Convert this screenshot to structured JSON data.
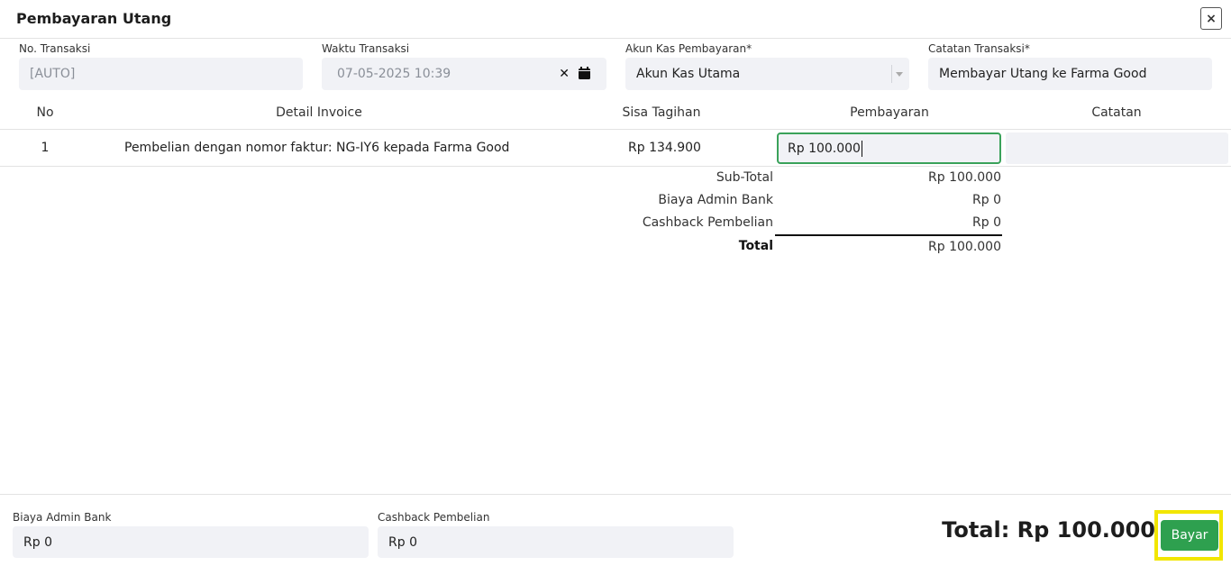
{
  "header": {
    "title": "Pembayaran Utang",
    "close_label": "×"
  },
  "fields": {
    "no_transaksi": {
      "label": "No. Transaksi",
      "value": "[AUTO]"
    },
    "waktu_transaksi": {
      "label": "Waktu Transaksi",
      "value": "07-05-2025 10:39"
    },
    "akun_kas": {
      "label": "Akun Kas Pembayaran*",
      "value": "Akun Kas Utama"
    },
    "catatan": {
      "label": "Catatan Transaksi*",
      "value": "Membayar Utang ke Farma Good"
    }
  },
  "table": {
    "headers": [
      "No",
      "Detail Invoice",
      "Sisa Tagihan",
      "Pembayaran",
      "Catatan"
    ],
    "rows": [
      {
        "no": "1",
        "detail": "Pembelian dengan nomor faktur: NG-IY6 kepada Farma Good",
        "sisa": "Rp 134.900",
        "pembayaran": "Rp 100.000",
        "catatan": ""
      }
    ]
  },
  "summary": {
    "subtotal_label": "Sub-Total",
    "subtotal_value": "Rp 100.000",
    "admin_label": "Biaya Admin Bank",
    "admin_value": "Rp 0",
    "cashback_label": "Cashback Pembelian",
    "cashback_value": "Rp 0",
    "total_label": "Total",
    "total_value": "Rp 100.000"
  },
  "footer": {
    "admin_label": "Biaya Admin Bank",
    "admin_value": "Rp 0",
    "cashback_label": "Cashback Pembelian",
    "cashback_value": "Rp 0",
    "grand_total": "Total: Rp 100.000",
    "pay_button": "Bayar"
  },
  "colors": {
    "accent_green": "#2ea04f",
    "highlight": "#f2e600",
    "field_bg": "#f1f2f6"
  },
  "icons": [
    "close-icon",
    "clear-icon",
    "calendar-icon",
    "chevron-down-icon"
  ]
}
